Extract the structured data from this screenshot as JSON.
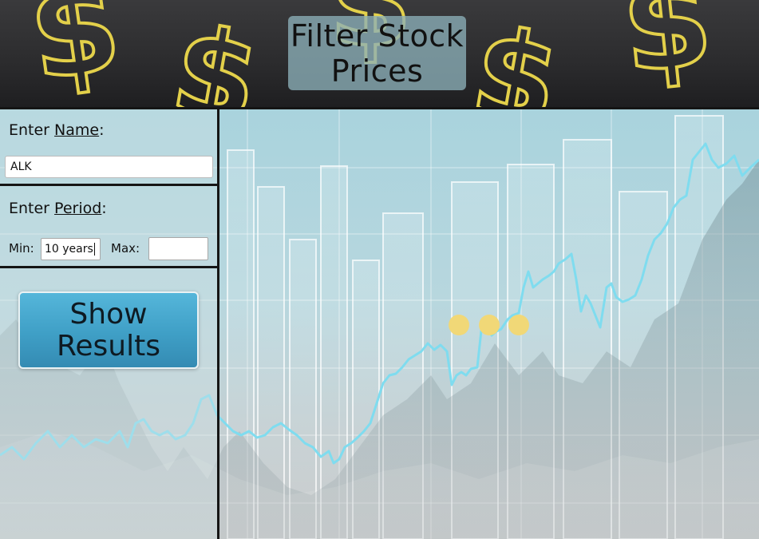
{
  "header": {
    "title_line1": "Filter Stock",
    "title_line2": "Prices",
    "decor_symbol": "$",
    "accent_color": "#e3d04a"
  },
  "form": {
    "name_label_prefix": "Enter ",
    "name_label_underlined": "Name",
    "name_label_suffix": ":",
    "name_value": "ALK",
    "period_label_prefix": "Enter ",
    "period_label_underlined": "Period",
    "period_label_suffix": ":",
    "min_label": "Min:",
    "min_value": "10 years",
    "max_label": "Max:",
    "max_value": "",
    "show_button_line1": "Show",
    "show_button_line2": "Results",
    "button_color": "#45a7cd"
  },
  "loading": {
    "indicator": "loading-dots",
    "dot_color": "#f1d877",
    "dot_count": 3
  }
}
